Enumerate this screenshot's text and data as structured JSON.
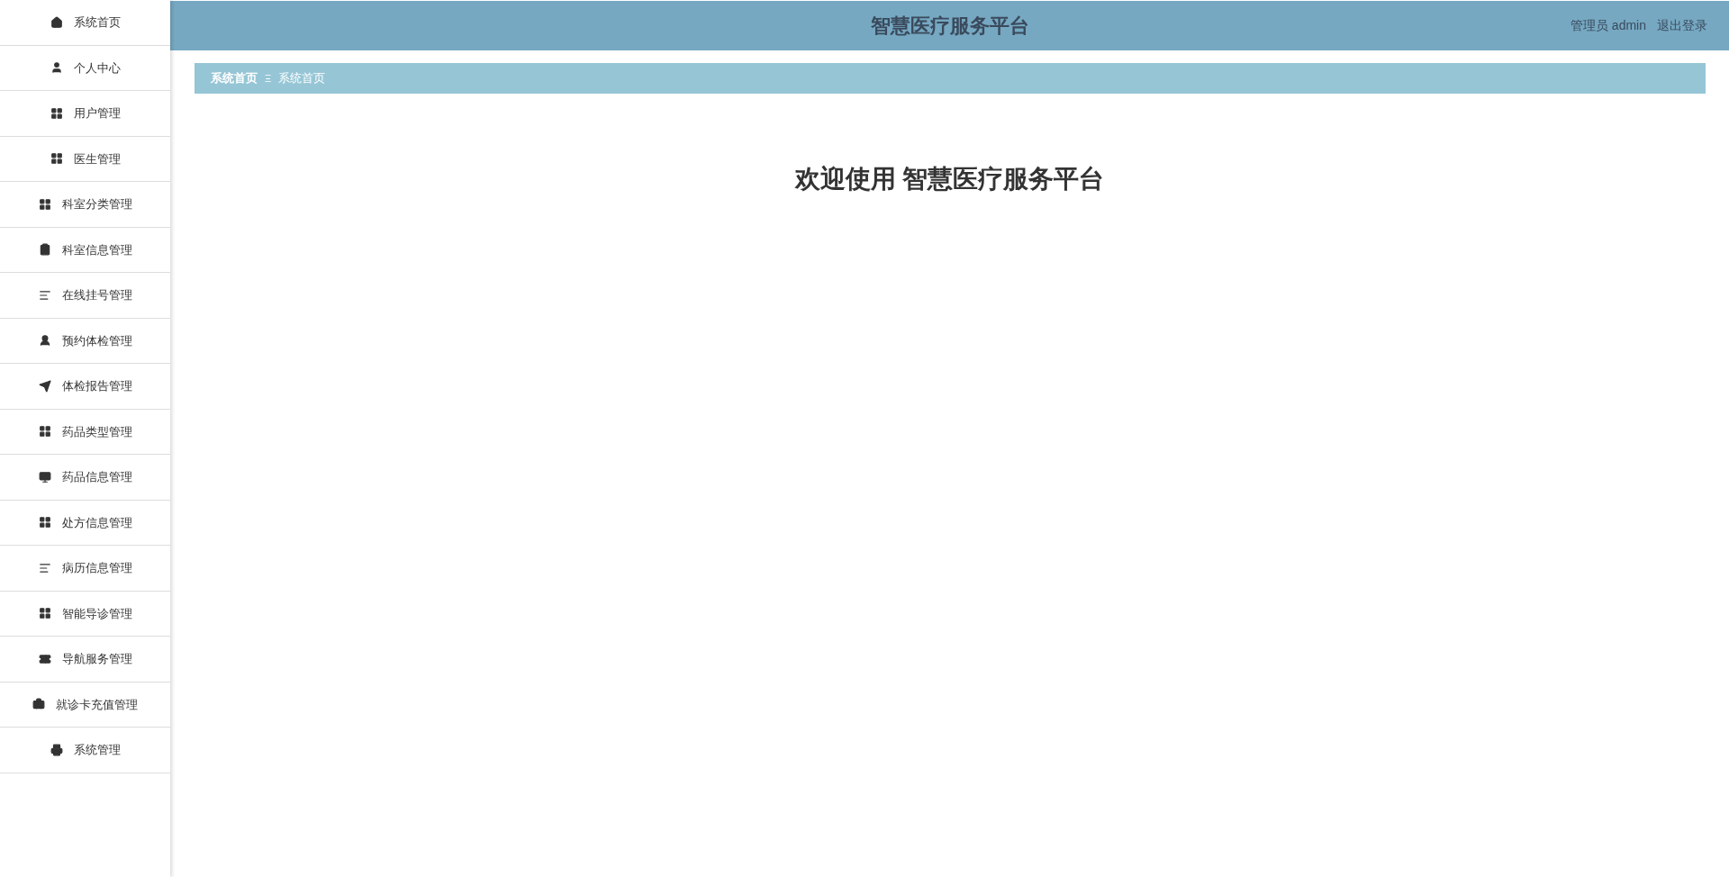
{
  "sidebar": {
    "items": [
      {
        "label": "系统首页",
        "kind": "home"
      },
      {
        "label": "个人中心",
        "kind": "user"
      },
      {
        "label": "用户管理",
        "kind": "grid"
      },
      {
        "label": "医生管理",
        "kind": "grid"
      },
      {
        "label": "科室分类管理",
        "kind": "grid"
      },
      {
        "label": "科室信息管理",
        "kind": "clipboard"
      },
      {
        "label": "在线挂号管理",
        "kind": "list"
      },
      {
        "label": "预约体检管理",
        "kind": "users"
      },
      {
        "label": "体检报告管理",
        "kind": "send"
      },
      {
        "label": "药品类型管理",
        "kind": "grid"
      },
      {
        "label": "药品信息管理",
        "kind": "monitor"
      },
      {
        "label": "处方信息管理",
        "kind": "grid"
      },
      {
        "label": "病历信息管理",
        "kind": "list"
      },
      {
        "label": "智能导诊管理",
        "kind": "grid"
      },
      {
        "label": "导航服务管理",
        "kind": "ticket"
      },
      {
        "label": "就诊卡充值管理",
        "kind": "briefcase"
      },
      {
        "label": "系统管理",
        "kind": "printer"
      }
    ]
  },
  "header": {
    "title": "智慧医疗服务平台",
    "user": "管理员 admin",
    "logout": "退出登录"
  },
  "breadcrumb": {
    "items": [
      "系统首页",
      "系统首页"
    ],
    "separator": "Ξ"
  },
  "welcome": "欢迎使用 智慧医疗服务平台"
}
